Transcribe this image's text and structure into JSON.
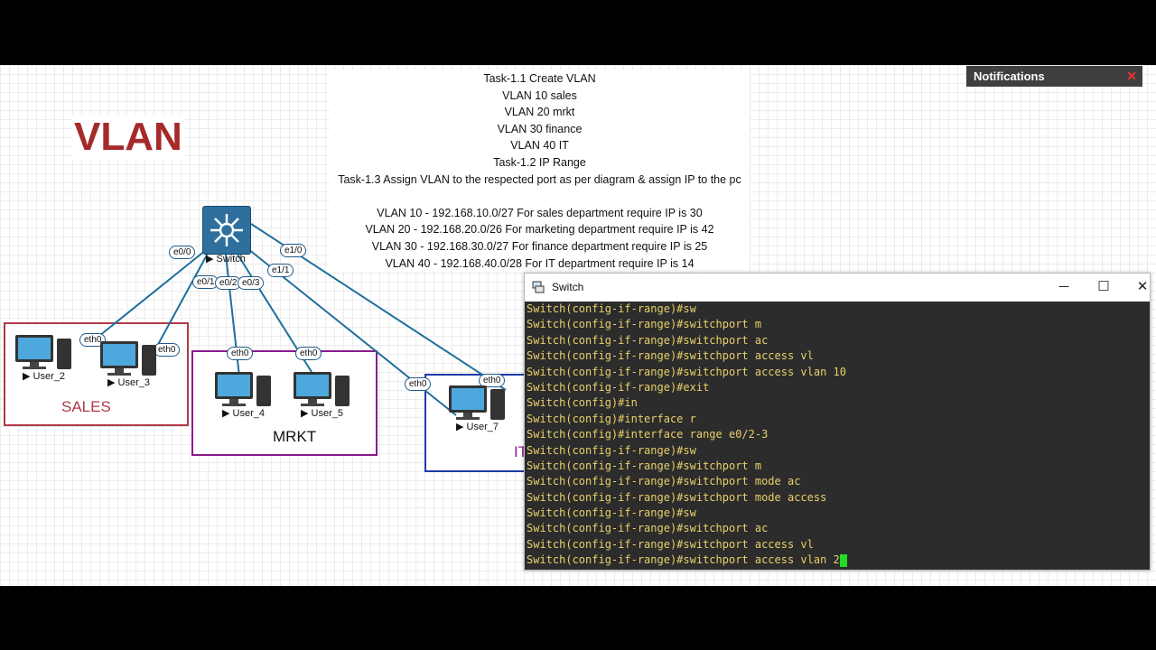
{
  "diagram": {
    "title": "VLAN",
    "tasks": [
      "Task-1.1 Create VLAN",
      "VLAN 10 sales",
      "VLAN 20 mrkt",
      "VLAN 30 finance",
      "VLAN 40 IT",
      "Task-1.2 IP Range",
      "Task-1.3 Assign VLAN to the respected port as per diagram & assign IP to the pc",
      "",
      "VLAN 10 - 192.168.10.0/27 For sales department require IP is 30",
      "VLAN 20 - 192.168.20.0/26 For marketing department require IP is 42",
      "VLAN 30 - 192.168.30.0/27 For finance department require IP is 25",
      "VLAN 40 - 192.168.40.0/28 For IT department require IP is 14"
    ],
    "switch_label": "Switch",
    "ports": {
      "e00": "e0/0",
      "e01": "e0/1",
      "e02": "e0/2",
      "e03": "e0/3",
      "e10": "e1/0",
      "e11": "e1/1",
      "eth0": "eth0"
    },
    "groups": {
      "sales": "SALES",
      "mrkt": "MRKT",
      "it": "IT"
    },
    "hosts": {
      "user2": "User_2",
      "user3": "User_3",
      "user4": "User_4",
      "user5": "User_5",
      "user7": "User_7"
    },
    "colors": {
      "sales": "#b03a48",
      "mrkt": "#8b1a8b",
      "it": "#1c3aa8",
      "link": "#1f6f9c"
    }
  },
  "notifications": {
    "title": "Notifications",
    "close": "✕"
  },
  "terminal": {
    "title": "Switch",
    "minimize": "─",
    "maximize": "☐",
    "close": "✕",
    "lines": [
      "Switch(config-if-range)#sw",
      "Switch(config-if-range)#switchport m",
      "Switch(config-if-range)#switchport ac",
      "Switch(config-if-range)#switchport access vl",
      "Switch(config-if-range)#switchport access vlan 10",
      "Switch(config-if-range)#exit",
      "Switch(config)#in",
      "Switch(config)#interface r",
      "Switch(config)#interface range e0/2-3",
      "Switch(config-if-range)#sw",
      "Switch(config-if-range)#switchport m",
      "Switch(config-if-range)#switchport mode ac",
      "Switch(config-if-range)#switchport mode access",
      "Switch(config-if-range)#sw",
      "Switch(config-if-range)#switchport ac",
      "Switch(config-if-range)#switchport access vl",
      "Switch(config-if-range)#switchport access vlan 2"
    ]
  }
}
